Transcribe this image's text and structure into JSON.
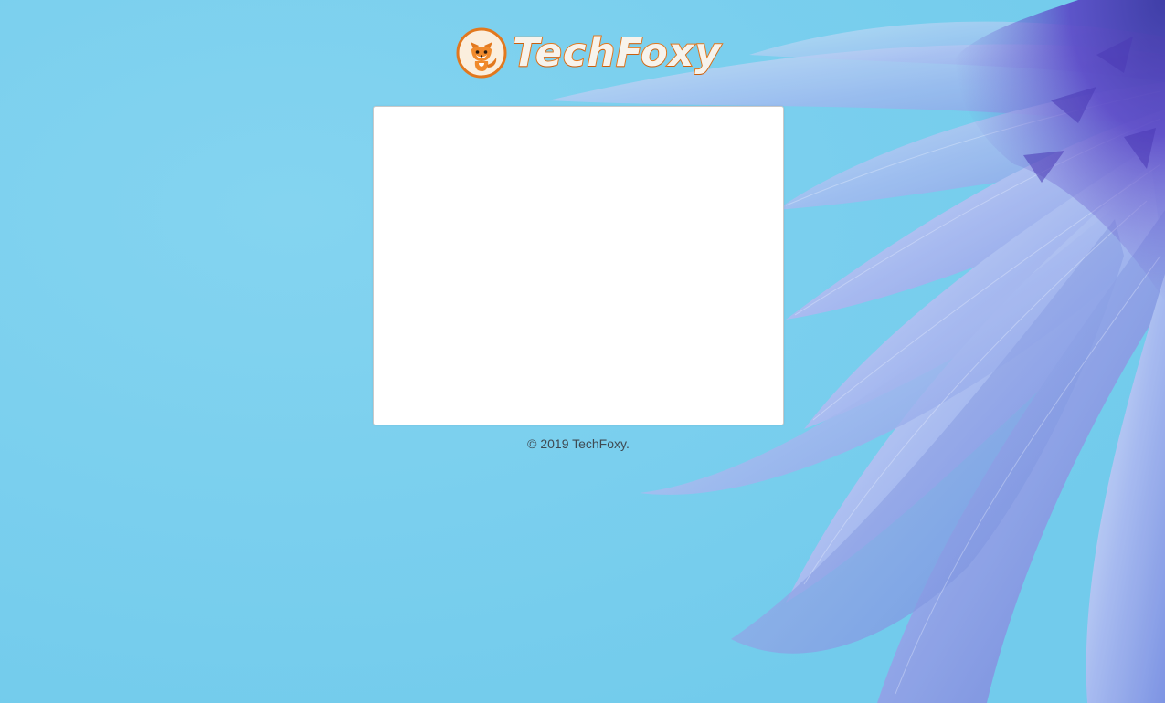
{
  "brand": {
    "name": "TechFoxy",
    "logo_icon": "fox-mascot-icon",
    "accent_color": "#e2781e"
  },
  "background": {
    "base_color": "#79cfee",
    "image": "blue-daisy-petals"
  },
  "card": {
    "background_color": "#ffffff"
  },
  "footer": {
    "copyright": "© 2019 TechFoxy."
  }
}
